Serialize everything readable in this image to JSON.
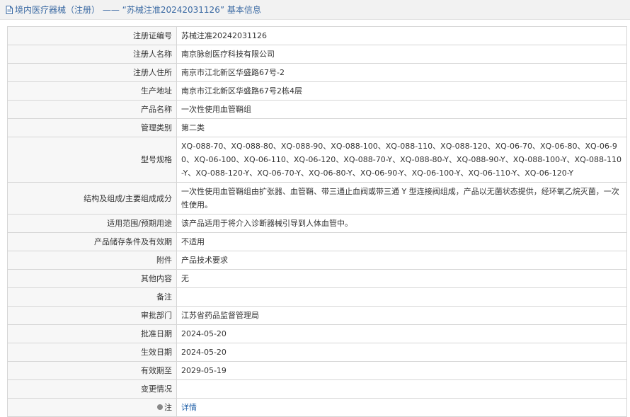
{
  "header": {
    "title": "境内医疗器械（注册） —— “苏械注准20242031126” 基本信息"
  },
  "rows": [
    {
      "label": "注册证编号",
      "value": "苏械注准20242031126"
    },
    {
      "label": "注册人名称",
      "value": "南京脉创医疗科技有限公司"
    },
    {
      "label": "注册人住所",
      "value": "南京市江北新区华盛路67号-2"
    },
    {
      "label": "生产地址",
      "value": "南京市江北新区华盛路67号2栋4层"
    },
    {
      "label": "产品名称",
      "value": "一次性使用血管鞘组"
    },
    {
      "label": "管理类别",
      "value": "第二类"
    },
    {
      "label": "型号规格",
      "value": "XQ-088-70、XQ-088-80、XQ-088-90、XQ-088-100、XQ-088-110、XQ-088-120、XQ-06-70、XQ-06-80、XQ-06-90、XQ-06-100、XQ-06-110、XQ-06-120、XQ-088-70-Y、XQ-088-80-Y、XQ-088-90-Y、XQ-088-100-Y、XQ-088-110-Y、XQ-088-120-Y、XQ-06-70-Y、XQ-06-80-Y、XQ-06-90-Y、XQ-06-100-Y、XQ-06-110-Y、XQ-06-120-Y"
    },
    {
      "label": "结构及组成/主要组成成分",
      "value": "一次性使用血管鞘组由扩张器、血管鞘、带三通止血阀或带三通 Y 型连接阀组成，产品以无菌状态提供，经环氧乙烷灭菌，一次性使用。"
    },
    {
      "label": "适用范围/预期用途",
      "value": "该产品适用于将介入诊断器械引导到人体血管中。"
    },
    {
      "label": "产品储存条件及有效期",
      "value": "不适用"
    },
    {
      "label": "附件",
      "value": "产品技术要求"
    },
    {
      "label": "其他内容",
      "value": "无"
    },
    {
      "label": "备注",
      "value": ""
    },
    {
      "label": "审批部门",
      "value": "江苏省药品监督管理局"
    },
    {
      "label": "批准日期",
      "value": "2024-05-20"
    },
    {
      "label": "生效日期",
      "value": "2024-05-20"
    },
    {
      "label": "有效期至",
      "value": "2029-05-19"
    },
    {
      "label": "变更情况",
      "value": ""
    }
  ],
  "note_row": {
    "label": "注",
    "link_text": "详情"
  },
  "colors": {
    "header_text": "#3b6aa3",
    "link": "#1f5fa8",
    "label_bg": "#f7f7f7",
    "border": "#d6d6d6"
  }
}
